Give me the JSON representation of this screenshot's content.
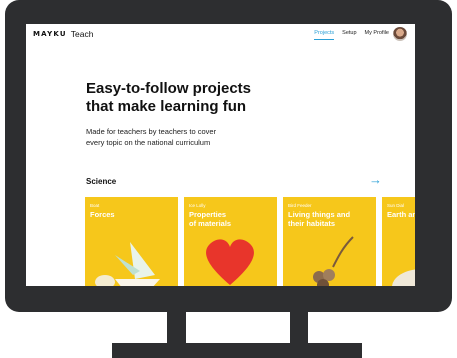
{
  "brand": {
    "wordmark": "MAYKU",
    "app": "Teach"
  },
  "nav": {
    "links": [
      "Projects",
      "Setup",
      "My Profile"
    ]
  },
  "hero": {
    "headline_line1": "Easy-to-follow projects",
    "headline_line2": "that make learning fun",
    "subtitle_line1": "Made for teachers by teachers to cover",
    "subtitle_line2": "every topic on the national curriculum"
  },
  "section": {
    "title": "Science",
    "arrow": "→"
  },
  "cards": [
    {
      "tag": "Boat",
      "title_line1": "Forces",
      "title_line2": ""
    },
    {
      "tag": "Ice Lolly",
      "title_line1": "Properties",
      "title_line2": "of materials"
    },
    {
      "tag": "Bird Feeder",
      "title_line1": "Living things and",
      "title_line2": "their habitats"
    },
    {
      "tag": "Sun Dial",
      "title_line1": "Earth and Sp",
      "title_line2": ""
    }
  ],
  "colors": {
    "accent": "#2a9fd6",
    "card_yellow": "#f6c71b",
    "monitor": "#2d2e30"
  }
}
